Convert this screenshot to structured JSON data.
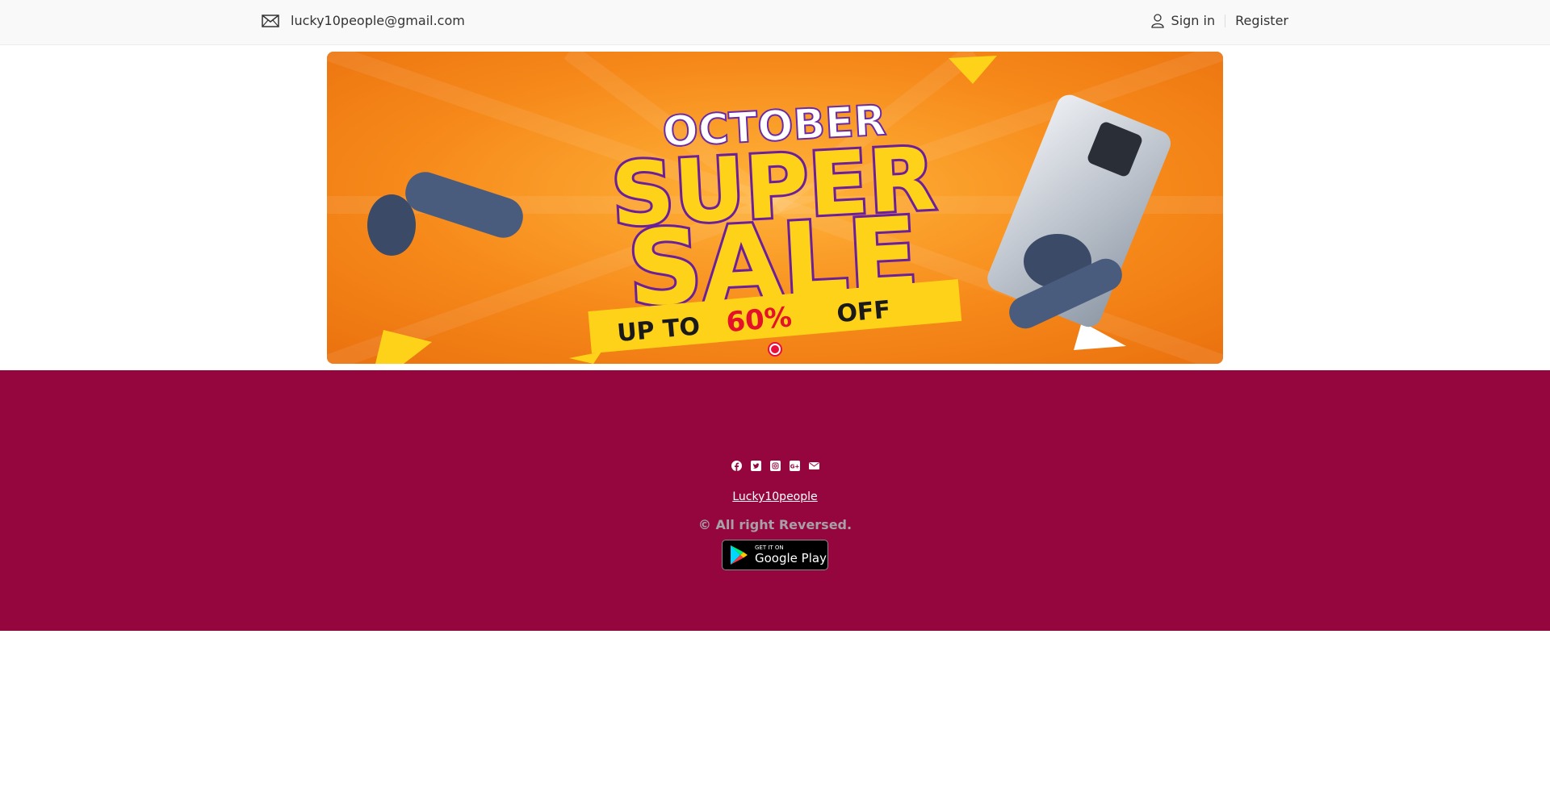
{
  "header": {
    "email": "lucky10people@gmail.com",
    "signin_label": "Sign in",
    "register_label": "Register"
  },
  "banner": {
    "line1": "OCTOBER",
    "line2": "SUPER",
    "line3": "SALE",
    "offer_prefix": "UP TO",
    "offer_value": "60%",
    "offer_suffix": "OFF",
    "slide_count": 1,
    "active_slide": 1
  },
  "footer": {
    "social_icons": [
      "facebook-icon",
      "twitter-icon",
      "instagram-icon",
      "google-plus-icon",
      "envelope-icon"
    ],
    "brand_link": "Lucky10people",
    "copyright": "© All right Reversed.",
    "store_badge_small": "GET IT ON",
    "store_badge_big": "Google Play",
    "background_color": "#96063e"
  }
}
